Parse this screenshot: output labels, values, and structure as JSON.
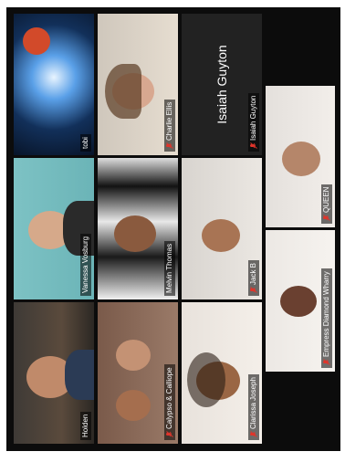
{
  "participants": [
    {
      "name": "Holden",
      "muted": false
    },
    {
      "name": "Vanessa Vosburg",
      "muted": false,
      "active_speaker": true
    },
    {
      "name": "tobi",
      "muted": false
    },
    {
      "name": "Calypso & Calliope",
      "muted": true
    },
    {
      "name": "Melvin Thomas",
      "muted": false
    },
    {
      "name": "Charlie Ellis",
      "muted": true
    },
    {
      "name": "Clarissa Joseph",
      "muted": true
    },
    {
      "name": "Jack B",
      "muted": true
    },
    {
      "name": "Isaiah Guyton",
      "muted": true,
      "video_off": true,
      "placeholder_name": "Isaiah Guyton"
    },
    {
      "name": "Empress Diamond Wharry",
      "muted": true
    },
    {
      "name": "QUEEN",
      "muted": true
    }
  ],
  "colors": {
    "active_border": "#c9e36b",
    "mute_icon": "#e0352b",
    "background": "#0c0c0c"
  },
  "icons": {
    "mute": "mic-off-icon"
  }
}
